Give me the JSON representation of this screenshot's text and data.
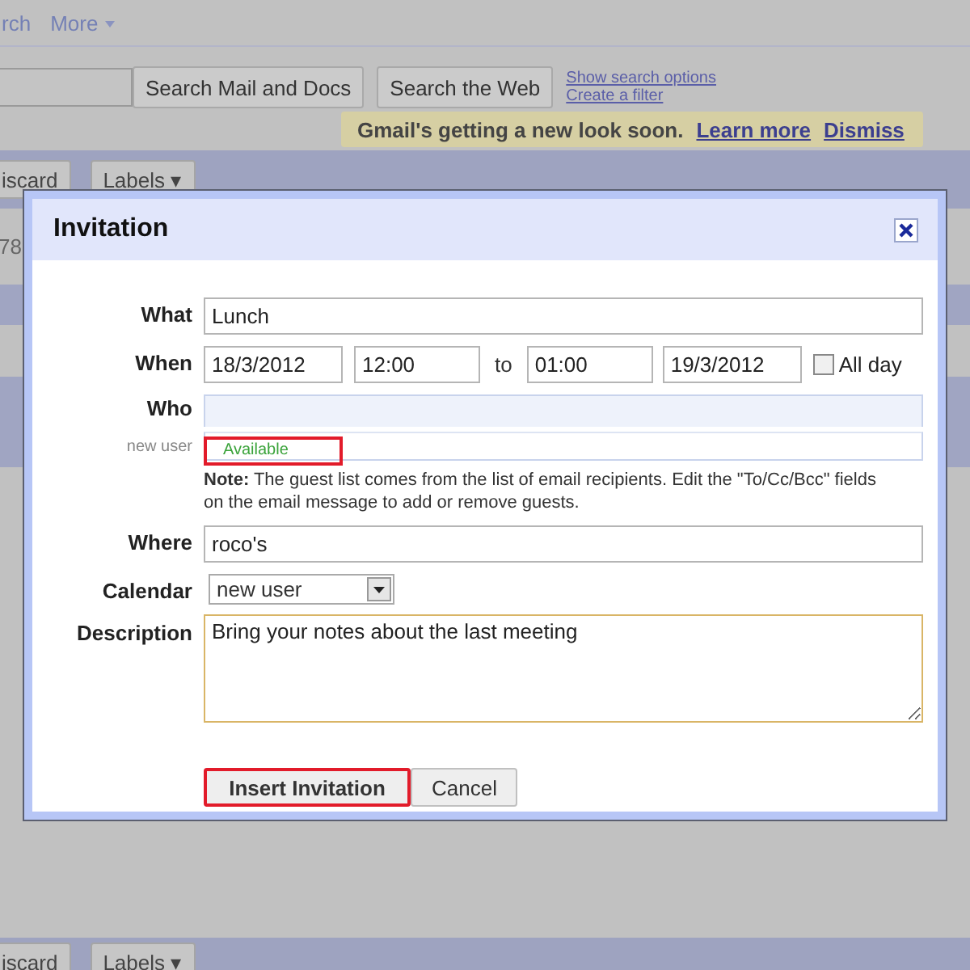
{
  "nav_links": [
    {
      "label": "rch",
      "dropdown": false
    },
    {
      "label": "More",
      "dropdown": true
    }
  ],
  "search": {
    "buttons": [
      "Search Mail and Docs",
      "Search the Web"
    ],
    "links": [
      "Show search options",
      "Create a filter"
    ]
  },
  "notice": {
    "text": "Gmail's getting a new look soon.",
    "links": [
      "Learn more",
      "Dismiss"
    ]
  },
  "toolbar_top": {
    "buttons": [
      "iscard",
      "Labels ▾"
    ]
  },
  "row_text": "78",
  "toolbar_bottom": {
    "buttons": [
      "iscard",
      "Labels ▾"
    ]
  },
  "dialog": {
    "title": "Invitation",
    "what": {
      "label": "What",
      "value": "Lunch"
    },
    "when": {
      "label": "When",
      "start_date": "18/3/2012",
      "start_time": "12:00",
      "separator": "to",
      "end_time": "01:00",
      "end_date": "19/3/2012",
      "all_day": {
        "label": "All day",
        "checked": false
      }
    },
    "who": {
      "label": "Who",
      "guests": [
        {
          "name": "new user",
          "status": "Available",
          "highlighted": true
        }
      ]
    },
    "note": "**Note:** The guest list comes from the list of email recipients. Edit the \"To/Cc/Bcc\" fields on the email message to add or remove guests.",
    "where": {
      "label": "Where",
      "value": "roco's"
    },
    "calendar": {
      "label": "Calendar",
      "value": "new user"
    },
    "description": {
      "label": "Description",
      "value": "Bring your notes about the last meeting"
    },
    "buttons": [
      {
        "label": "Insert Invitation",
        "highlighted": true
      },
      {
        "label": "Cancel",
        "highlighted": false
      }
    ]
  }
}
